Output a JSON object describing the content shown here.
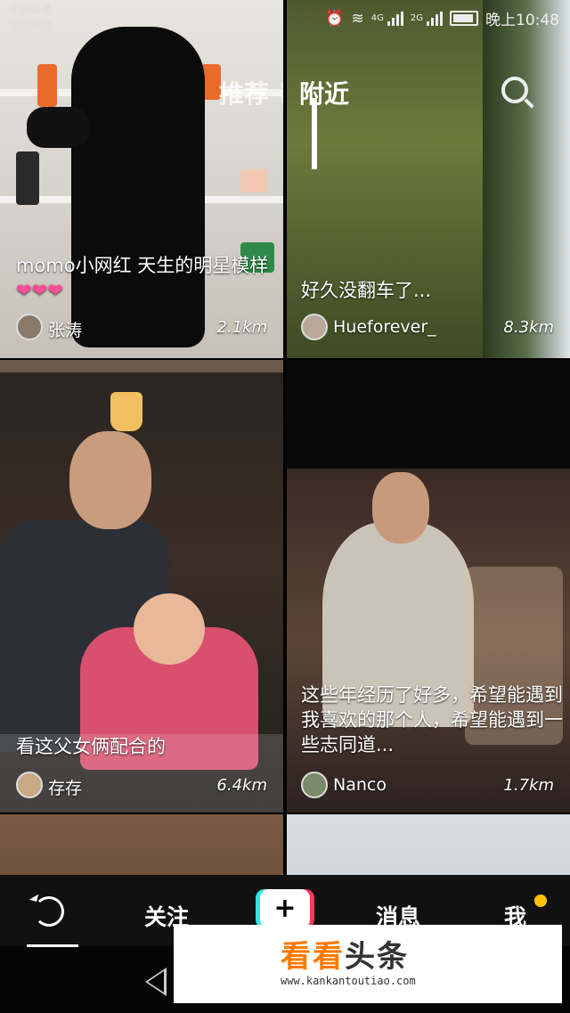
{
  "status_bar": {
    "carrier_1": "中国联通",
    "carrier_2": "中国移动",
    "net_1": "4G",
    "net_2": "2G",
    "time": "晚上10:48"
  },
  "top_tabs": [
    {
      "label": "推荐",
      "active": false
    },
    {
      "label": "附近",
      "active": true
    }
  ],
  "cards": [
    {
      "caption": "momo小网红 天生的明星模样",
      "hearts": "❤❤❤",
      "user": "张涛",
      "distance": "2.1km"
    },
    {
      "caption": "好久没翻车了...",
      "user": "Hueforever_",
      "distance": "8.3km"
    },
    {
      "caption": "看这父女俩配合的",
      "user": "存存",
      "distance": "6.4km"
    },
    {
      "caption": "这些年经历了好多，希望能遇到我喜欢的那个人，希望能遇到一些志同道...",
      "user": "Nanco",
      "distance": "1.7km"
    }
  ],
  "bottom_nav": {
    "items": [
      {
        "label": "",
        "icon": "refresh-icon",
        "active": true
      },
      {
        "label": "关注"
      },
      {
        "label": "+",
        "icon": "create-plus-icon"
      },
      {
        "label": "消息"
      },
      {
        "label": "我",
        "badge_color": "#ffc400"
      }
    ]
  },
  "watermark": {
    "brand_orange": "看看",
    "brand_dark": "头条",
    "url": "www.kankantoutiao.com"
  },
  "colors": {
    "accent_cyan": "#2ee6e6",
    "accent_red": "#ff3b5c",
    "heart_pink": "#ff4f9a"
  }
}
